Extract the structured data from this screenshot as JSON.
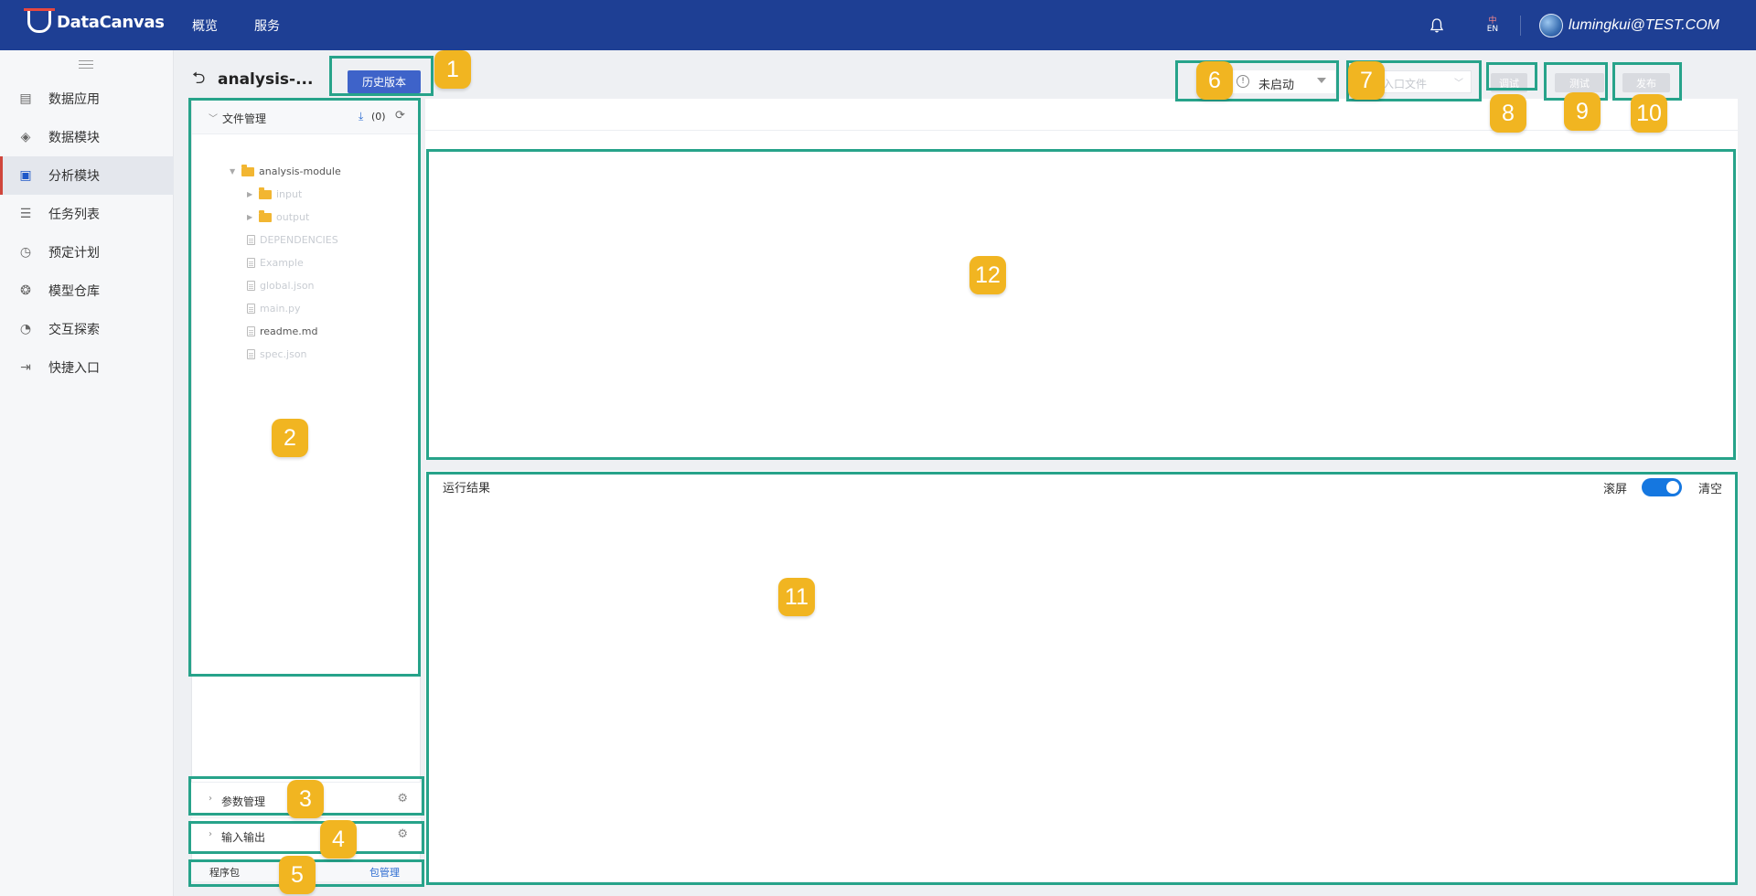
{
  "topbar": {
    "logo_text": "DataCanvas",
    "nav": [
      "概览",
      "服务"
    ],
    "lang_cn": "中",
    "lang_en": "EN",
    "user": "lumingkui@TEST.COM",
    "bg_color": "#1e3f94"
  },
  "sidebar": {
    "items": [
      {
        "label": "数据应用",
        "icon": "app-icon"
      },
      {
        "label": "数据模块",
        "icon": "layers-icon"
      },
      {
        "label": "分析模块",
        "icon": "monitor-icon",
        "active": true
      },
      {
        "label": "任务列表",
        "icon": "list-icon"
      },
      {
        "label": "预定计划",
        "icon": "schedule-icon"
      },
      {
        "label": "模型仓库",
        "icon": "model-icon"
      },
      {
        "label": "交互探索",
        "icon": "explore-icon"
      },
      {
        "label": "快捷入口",
        "icon": "entry-icon"
      }
    ]
  },
  "page": {
    "title": "analysis-...",
    "history_button": "历史版本"
  },
  "file_panel": {
    "title": "文件管理",
    "upload_count": "(0)",
    "tree": {
      "root": "analysis-module",
      "folders": [
        "input",
        "output"
      ],
      "files": [
        "DEPENDENCIES",
        "Example",
        "global.json",
        "main.py",
        "readme.md",
        "spec.json"
      ]
    }
  },
  "params": {
    "label": "参数管理"
  },
  "io": {
    "label": "输入输出"
  },
  "package": {
    "label": "程序包",
    "link": "包管理"
  },
  "toolbar": {
    "status": "未启动",
    "entry_placeholder": "入口文件",
    "debug": "调试",
    "test": "测试",
    "publish": "发布"
  },
  "results": {
    "title": "运行结果",
    "scroll_label": "滚屏",
    "scroll_on": true,
    "clear": "清空"
  },
  "callouts": [
    "1",
    "2",
    "3",
    "4",
    "5",
    "6",
    "7",
    "8",
    "9",
    "10",
    "11",
    "12"
  ],
  "colors": {
    "accent": "#3e63c9",
    "callout": "#27a38a",
    "badge": "#f1b521",
    "active_marker": "#d0463c"
  }
}
